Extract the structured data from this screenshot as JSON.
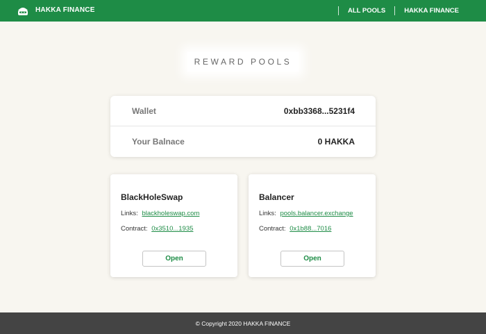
{
  "header": {
    "brand": "HAKKA FINANCE",
    "logo_icon": "hakka-ninja-logo-icon",
    "nav": [
      {
        "label": "ALL POOLS"
      },
      {
        "label": "HAKKA FINANCE"
      }
    ],
    "color": "#1e8c46"
  },
  "page": {
    "title": "REWARD POOLS"
  },
  "wallet": {
    "wallet_label": "Wallet",
    "wallet_value": "0xbb3368...5231f4",
    "balance_label": "Your Balnace",
    "balance_value": "0 HAKKA"
  },
  "pools": [
    {
      "name": "BlackHoleSwap",
      "links_label": "Links:",
      "link": "blackholeswap.com",
      "contract_label": "Contract:",
      "contract": "0x3510...1935",
      "button": "Open"
    },
    {
      "name": "Balancer",
      "links_label": "Links:",
      "link": "pools.balancer.exchange",
      "contract_label": "Contract:",
      "contract": "0x1b88...7016",
      "button": "Open"
    }
  ],
  "footer": {
    "text": "© Copyright 2020 HAKKA FINANCE"
  }
}
